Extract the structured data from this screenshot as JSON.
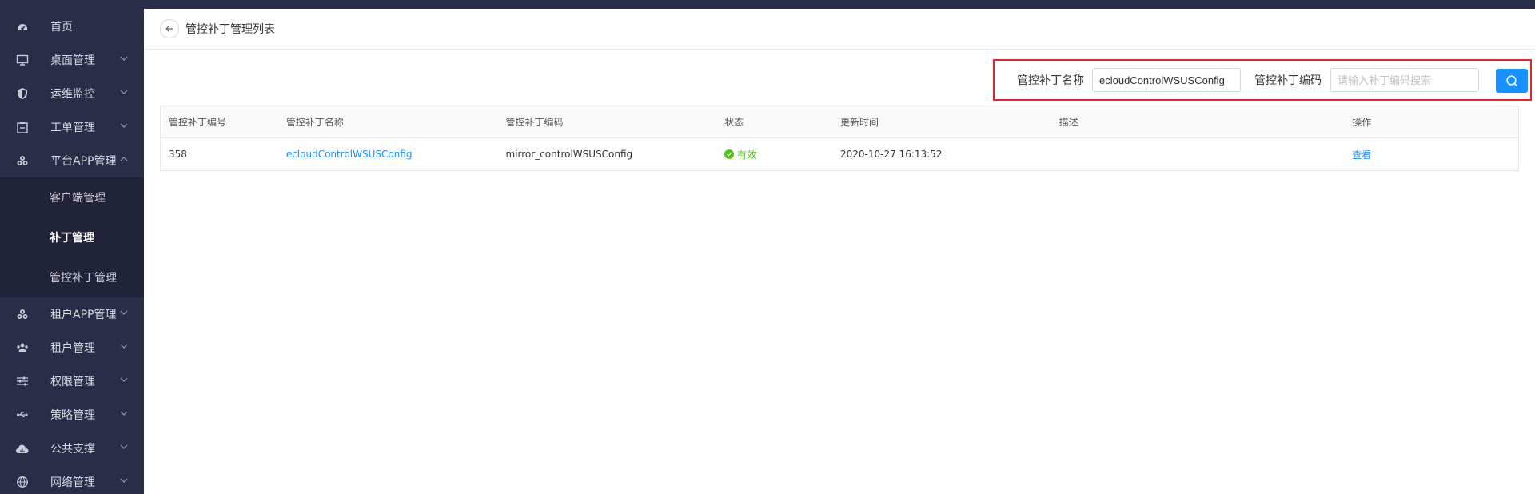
{
  "sidebar": {
    "items": [
      {
        "label": "首页",
        "icon": "dashboard-icon"
      },
      {
        "label": "桌面管理",
        "icon": "monitor-icon"
      },
      {
        "label": "运维监控",
        "icon": "shield-icon"
      },
      {
        "label": "工单管理",
        "icon": "clipboard-icon"
      },
      {
        "label": "平台APP管理",
        "icon": "cubes-icon"
      },
      {
        "label": "租户APP管理",
        "icon": "cubes-icon"
      },
      {
        "label": "租户管理",
        "icon": "users-icon"
      },
      {
        "label": "权限管理",
        "icon": "sliders-icon"
      },
      {
        "label": "策略管理",
        "icon": "usb-icon"
      },
      {
        "label": "公共支撑",
        "icon": "cloud-chart-icon"
      },
      {
        "label": "网络管理",
        "icon": "globe-icon"
      }
    ],
    "submenu": [
      {
        "label": "客户端管理"
      },
      {
        "label": "补丁管理"
      },
      {
        "label": "管控补丁管理"
      }
    ]
  },
  "header": {
    "title": "管控补丁管理列表"
  },
  "search": {
    "name_label": "管控补丁名称",
    "name_value": "ecloudControlWSUSConfig",
    "code_label": "管控补丁编码",
    "code_placeholder": "请输入补丁编码搜索"
  },
  "table": {
    "columns": [
      "管控补丁编号",
      "管控补丁名称",
      "管控补丁编码",
      "状态",
      "更新时间",
      "描述",
      "操作"
    ],
    "rows": [
      {
        "id": "358",
        "name": "ecloudControlWSUSConfig",
        "code": "mirror_controlWSUSConfig",
        "status": "有效",
        "updated": "2020-10-27 16:13:52",
        "desc": "",
        "action": "查看"
      }
    ]
  },
  "colors": {
    "sidebar_bg": "#2a2d47",
    "primary": "#1890ff",
    "success": "#52c41a",
    "highlight": "#e3262c"
  }
}
